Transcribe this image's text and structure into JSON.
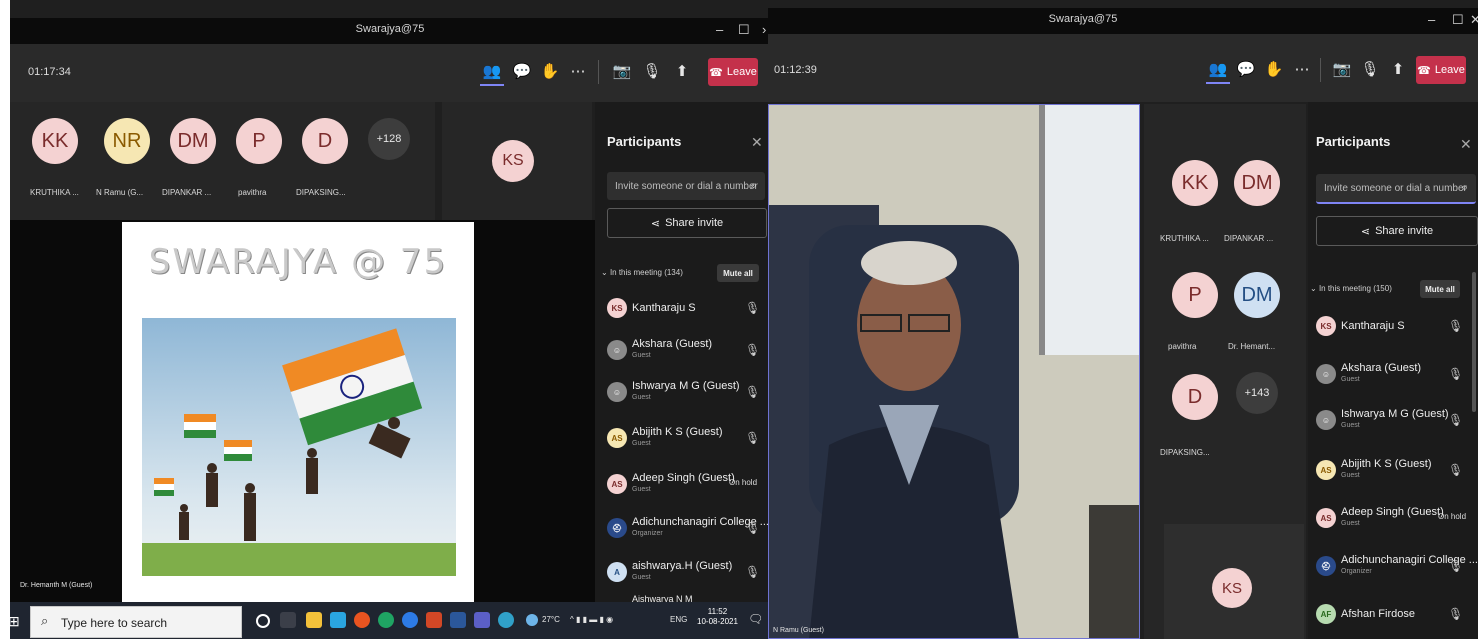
{
  "left": {
    "title": "Swarajya@75",
    "timer": "01:17:34",
    "leave_label": "Leave",
    "strip": [
      {
        "initials": "KK",
        "name": "KRUTHIKA ...",
        "color": "pink"
      },
      {
        "initials": "NR",
        "name": "N Ramu (G...",
        "color": "yellow"
      },
      {
        "initials": "DM",
        "name": "DIPANKAR ...",
        "color": "pink"
      },
      {
        "initials": "P",
        "name": "pavithra",
        "color": "pink"
      },
      {
        "initials": "D",
        "name": "DIPAKSING...",
        "color": "pink"
      }
    ],
    "overflow": "+128",
    "self_initials": "KS",
    "slide_title": "SWARAJYA @ 75",
    "caption": "Dr. Hemanth M (Guest)",
    "panel": {
      "title": "Participants",
      "invite_placeholder": "Invite someone or dial a number",
      "share_label": "Share invite",
      "meeting_label": "In this meeting (134)",
      "mute_all": "Mute all",
      "participants": [
        {
          "initials": "KS",
          "name": "Kantharaju S",
          "sub": "",
          "status": "muted"
        },
        {
          "initials": "",
          "name": "Akshara (Guest)",
          "sub": "Guest",
          "status": "muted"
        },
        {
          "initials": "",
          "name": "Ishwarya M G (Guest)",
          "sub": "Guest",
          "status": "muted"
        },
        {
          "initials": "AS",
          "name": "Abijith K S (Guest)",
          "sub": "Guest",
          "status": "muted"
        },
        {
          "initials": "AS",
          "name": "Adeep Singh (Guest)",
          "sub": "Guest",
          "status": "On hold"
        },
        {
          "initials": "",
          "name": "Adichunchanagiri College ...",
          "sub": "Organizer",
          "status": "muted"
        },
        {
          "initials": "A",
          "name": "aishwarya.H (Guest)",
          "sub": "Guest",
          "status": "muted"
        }
      ],
      "partial_row": "Aishwarya N M"
    }
  },
  "right": {
    "title": "Swarajya@75",
    "timer": "01:12:39",
    "leave_label": "Leave",
    "tiles": [
      {
        "initials": "KK",
        "name": "KRUTHIKA ...",
        "color": "pink"
      },
      {
        "initials": "DM",
        "name": "DIPANKAR ...",
        "color": "pink"
      },
      {
        "initials": "P",
        "name": "pavithra",
        "color": "pink"
      },
      {
        "initials": "DM",
        "name": "Dr. Hemant...",
        "color": "blue"
      },
      {
        "initials": "D",
        "name": "DIPAKSING...",
        "color": "pink"
      }
    ],
    "overflow": "+143",
    "self_initials": "KS",
    "caption": "N Ramu (Guest)",
    "panel": {
      "title": "Participants",
      "invite_placeholder": "Invite someone or dial a number",
      "share_label": "Share invite",
      "meeting_label": "In this meeting (150)",
      "mute_all": "Mute all",
      "participants": [
        {
          "initials": "KS",
          "name": "Kantharaju S",
          "sub": "",
          "status": "muted"
        },
        {
          "initials": "",
          "name": "Akshara (Guest)",
          "sub": "Guest",
          "status": "muted"
        },
        {
          "initials": "",
          "name": "Ishwarya M G (Guest)",
          "sub": "Guest",
          "status": "muted"
        },
        {
          "initials": "AS",
          "name": "Abijith K S (Guest)",
          "sub": "Guest",
          "status": "muted"
        },
        {
          "initials": "AS",
          "name": "Adeep Singh (Guest)",
          "sub": "Guest",
          "status": "On hold"
        },
        {
          "initials": "",
          "name": "Adichunchanagiri College ...",
          "sub": "Organizer",
          "status": "muted"
        },
        {
          "initials": "AF",
          "name": "Afshan Firdose",
          "sub": "",
          "status": "muted"
        }
      ]
    }
  },
  "taskbar": {
    "search_placeholder": "Type here to search",
    "weather": "27°C",
    "language": "ENG",
    "time": "11:52",
    "date": "10-08-2021"
  },
  "colors": {
    "leave": "#c4314b",
    "accent": "#7f85f5",
    "panel": "#1b1b1b"
  }
}
